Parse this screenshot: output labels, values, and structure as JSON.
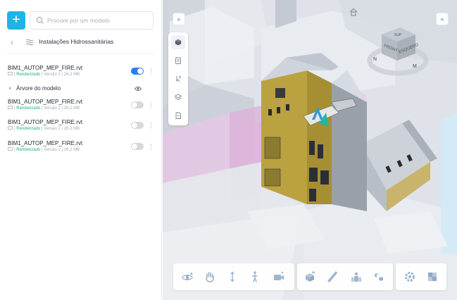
{
  "toolbar": {
    "add_label": "+"
  },
  "search": {
    "placeholder": "Procure por um modelo",
    "value": ""
  },
  "breadcrumb": {
    "title": "Instalações Hidrossanitárias"
  },
  "models": [
    {
      "name": "BIM1_AUTOP_MEP_FIRE.rvt",
      "status": "Renderizado",
      "version": "Versão 2",
      "size": "26.2 MB",
      "enabled": true
    },
    {
      "name": "BIM1_AUTOP_MEP_FIRE.rvt",
      "status": "Renderizado",
      "version": "Versão 2",
      "size": "26.2 MB",
      "enabled": false
    },
    {
      "name": "BIM1_AUTOP_MEP_FIRE.rvt",
      "status": "Renderizado",
      "version": "Versão 2",
      "size": "26.2 MB",
      "enabled": false
    },
    {
      "name": "BIM1_AUTOP_MEP_FIRE.rvt",
      "status": "Renderizado",
      "version": "Versão 2",
      "size": "26.2 MB",
      "enabled": false
    }
  ],
  "tree": {
    "label": "Árvore do modelo"
  },
  "navcube": {
    "front": "FRONT",
    "left": "ESQUERD",
    "top": "SUP",
    "compass_n": "N",
    "compass_m": "M"
  },
  "colors": {
    "accent": "#1fb4e6",
    "toggle_on": "#2c7df0",
    "status": "#1bb07c",
    "facade": "#b9a23f",
    "highlight": "#e7b6e3"
  },
  "viewport_tools": [
    "cube-icon",
    "clipboard-icon",
    "cursor-pin-icon",
    "layers-icon",
    "file-icon"
  ],
  "bottom_tools": {
    "navigation": [
      "orbit-icon",
      "pan-hand-icon",
      "zoom-arrows-icon",
      "walk-person-icon",
      "camera-icon"
    ],
    "analysis": [
      "section-box-icon",
      "measure-ruler-icon",
      "people-icon",
      "explode-cubes-icon"
    ],
    "settings": [
      "gear-icon",
      "fullscreen-icon"
    ]
  }
}
